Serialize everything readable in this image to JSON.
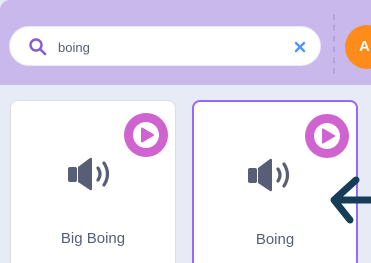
{
  "search": {
    "value": "boing",
    "icon": "search-icon",
    "clear_icon": "close-icon"
  },
  "add_button": {
    "label": "A"
  },
  "sounds": [
    {
      "label": "Big Boing",
      "play_icon": "play-icon",
      "icon": "speaker-icon",
      "selected": false
    },
    {
      "label": "Boing",
      "play_icon": "play-icon",
      "icon": "speaker-icon",
      "selected": true
    }
  ],
  "overlay": {
    "icon": "arrow-icon"
  },
  "colors": {
    "header": "#c9b8ec",
    "search_icon": "#855cd6",
    "clear_icon": "#4c97ff",
    "play_button": "#cf63cf",
    "selected_border": "#9966ff",
    "add_button": "#ff8c1a",
    "speaker": "#575e75",
    "arrow": "#163d57"
  }
}
